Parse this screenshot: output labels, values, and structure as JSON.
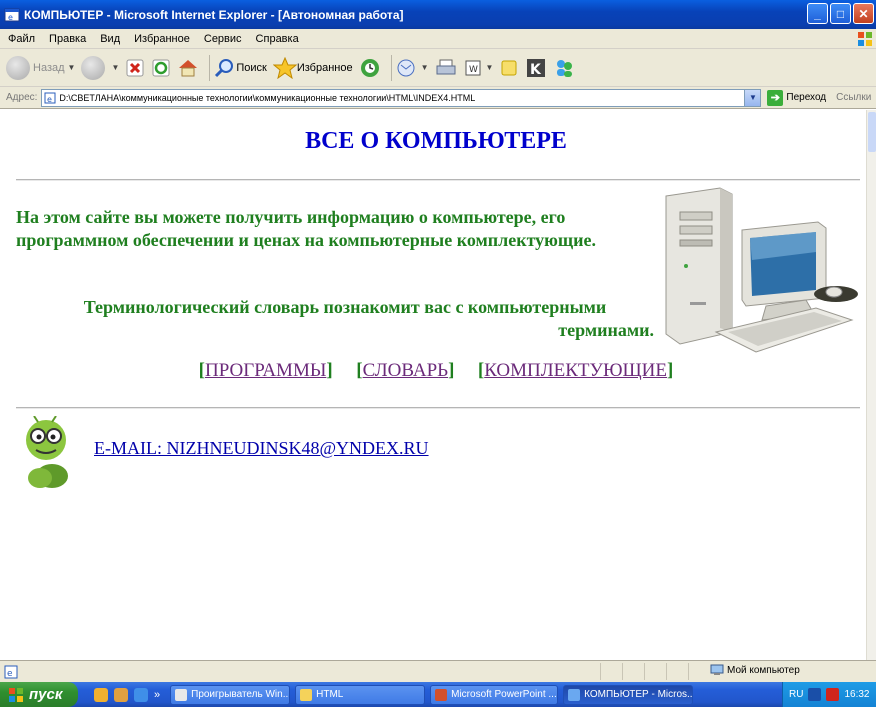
{
  "window": {
    "title": "КОМПЬЮТЕР - Microsoft Internet Explorer - [Автономная работа]"
  },
  "menu": {
    "items": [
      "Файл",
      "Правка",
      "Вид",
      "Избранное",
      "Сервис",
      "Справка"
    ]
  },
  "toolbar": {
    "back_label": "Назад",
    "search_label": "Поиск",
    "favorites_label": "Избранное"
  },
  "address": {
    "label": "Адрес:",
    "value": "D:\\СВЕТЛАНА\\коммуникационные технологии\\коммуникационные технологии\\HTML\\INDEX4.HTML",
    "go_label": "Переход",
    "links_label": "Ссылки"
  },
  "page": {
    "title": "ВСЕ О КОМПЬЮТЕРЕ",
    "intro": "На этом сайте вы можете получить информацию о компьютере, его программном обеспечении и ценах на компьютерные комплектующие.",
    "dict_line1": "Терминологический словарь познакомит вас с компьютерными",
    "dict_line2": "терминами.",
    "nav": [
      {
        "label": "ПРОГРАММЫ"
      },
      {
        "label": "СЛОВАРЬ"
      },
      {
        "label": "КОМПЛЕКТУЮЩИЕ"
      }
    ],
    "email": "E-MAIL: NIZHNEUDINSK48@YNDEX.RU"
  },
  "status": {
    "zone": "Мой компьютер"
  },
  "taskbar": {
    "start_label": "пуск",
    "tasks": [
      {
        "label": "Проигрыватель Win..."
      },
      {
        "label": "HTML"
      },
      {
        "label": "Microsoft PowerPoint ..."
      },
      {
        "label": "КОМПЬЮТЕР - Micros..."
      }
    ],
    "lang": "RU",
    "time": "16:32"
  }
}
